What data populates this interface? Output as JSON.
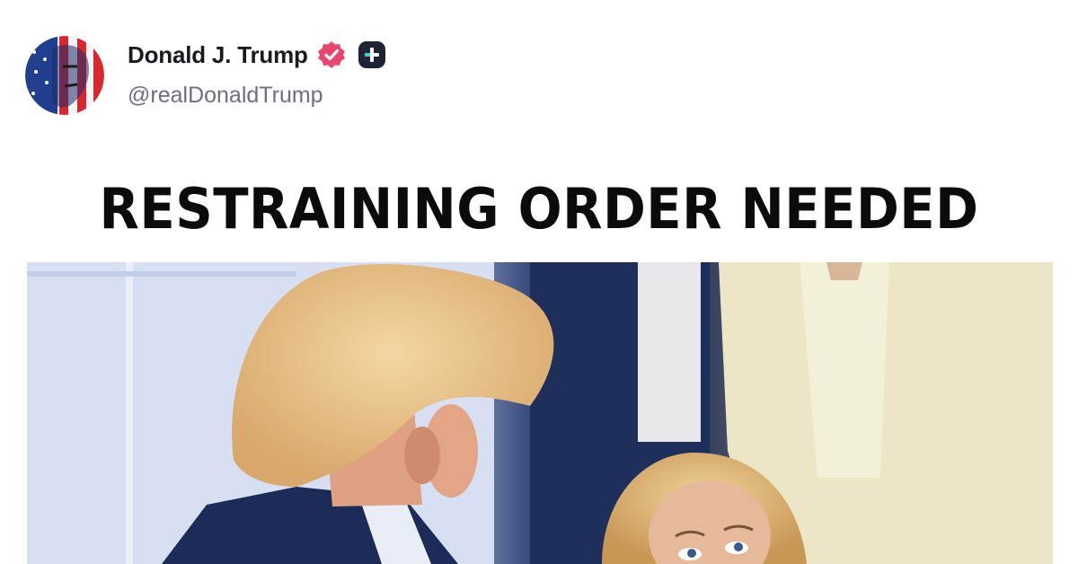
{
  "post": {
    "author": {
      "display_name": "Donald J. Trump",
      "handle": "@realDonaldTrump",
      "verified_icon": "verified-badge-icon",
      "plus_icon": "plus-badge-icon"
    },
    "image_headline": "RESTRAINING ORDER NEEDED",
    "media": {
      "type": "photo",
      "icon": "photo"
    }
  },
  "colors": {
    "verified_badge": "#e8466f",
    "plus_badge": "#1e2433",
    "name_text": "#1b1b1f",
    "handle_text": "#6b6f80",
    "headline_text": "#0b0b0b"
  }
}
